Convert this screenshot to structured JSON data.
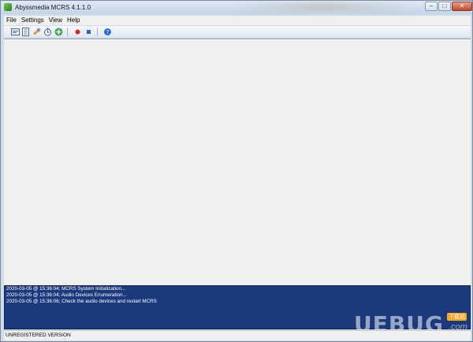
{
  "window": {
    "title": "Abyssmedia MCRS 4.1.1.0",
    "minimize_glyph": "–",
    "maximize_glyph": "□",
    "close_glyph": "✕"
  },
  "menu": {
    "items": [
      "File",
      "Settings",
      "View",
      "Help"
    ]
  },
  "toolbar": {
    "icons": [
      "log-icon",
      "list-icon",
      "devices-icon",
      "schedule-icon",
      "add-icon",
      "record-icon",
      "stop-icon",
      "help-icon"
    ]
  },
  "log": {
    "lines": [
      "2020-03-05 @ 15:36:04; MCRS System Initialization...",
      "2020-03-05 @ 15:36:04; Audio Devices Enumeration...",
      "2020-03-05 @ 15:36:06; Check the audio devices and restart MCRS"
    ]
  },
  "status": {
    "text": "UNREGISTERED VERSION"
  },
  "watermark": {
    "text": "UEBUG",
    "badge": "下载站",
    "suffix": ".com"
  },
  "colors": {
    "log_background": "#1b3a7e",
    "record": "#d9231e",
    "stop": "#3a5bd0",
    "add": "#3aa84a",
    "help": "#2b6bd6"
  }
}
